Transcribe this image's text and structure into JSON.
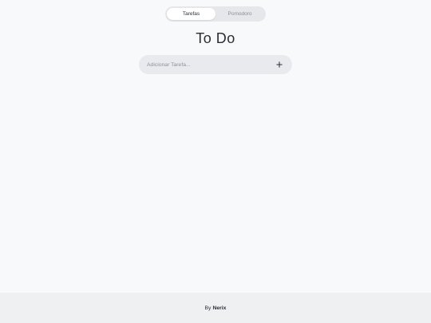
{
  "tabs": [
    {
      "label": "Tarefas",
      "active": true
    },
    {
      "label": "Pomodoro",
      "active": false
    }
  ],
  "title": "To Do",
  "add_task": {
    "placeholder": "Adicionar Tarefa...",
    "value": "",
    "button_icon": "plus-icon"
  },
  "footer": {
    "prefix": "By",
    "author": "Nerix"
  }
}
